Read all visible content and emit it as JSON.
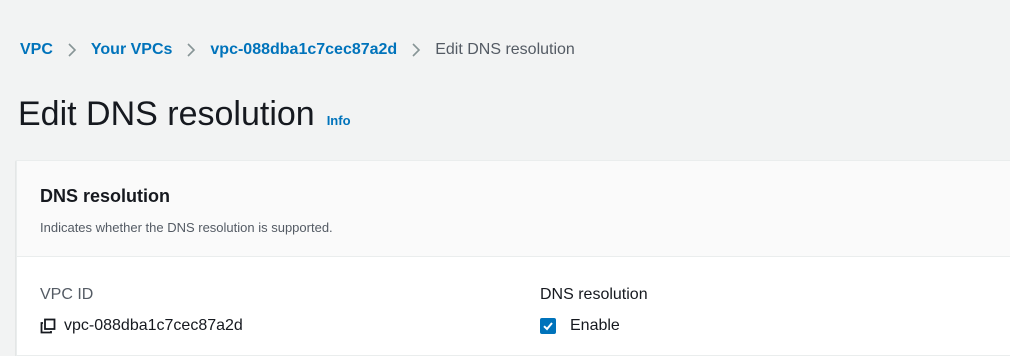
{
  "breadcrumb": {
    "items": [
      {
        "label": "VPC"
      },
      {
        "label": "Your VPCs"
      },
      {
        "label": "vpc-088dba1c7cec87a2d"
      }
    ],
    "current": "Edit DNS resolution"
  },
  "page": {
    "title": "Edit DNS resolution",
    "info_label": "Info"
  },
  "panel": {
    "title": "DNS resolution",
    "description": "Indicates whether the DNS resolution is supported.",
    "vpc_id_label": "VPC ID",
    "vpc_id_value": "vpc-088dba1c7cec87a2d",
    "dns_resolution_label": "DNS resolution",
    "enable_label": "Enable",
    "enable_checked": true
  },
  "colors": {
    "link": "#0073bb",
    "checkbox": "#0073bb",
    "background": "#f2f3f3"
  },
  "icons": {
    "separator": "chevron-right-icon",
    "copy": "copy-icon",
    "check": "check-icon"
  }
}
